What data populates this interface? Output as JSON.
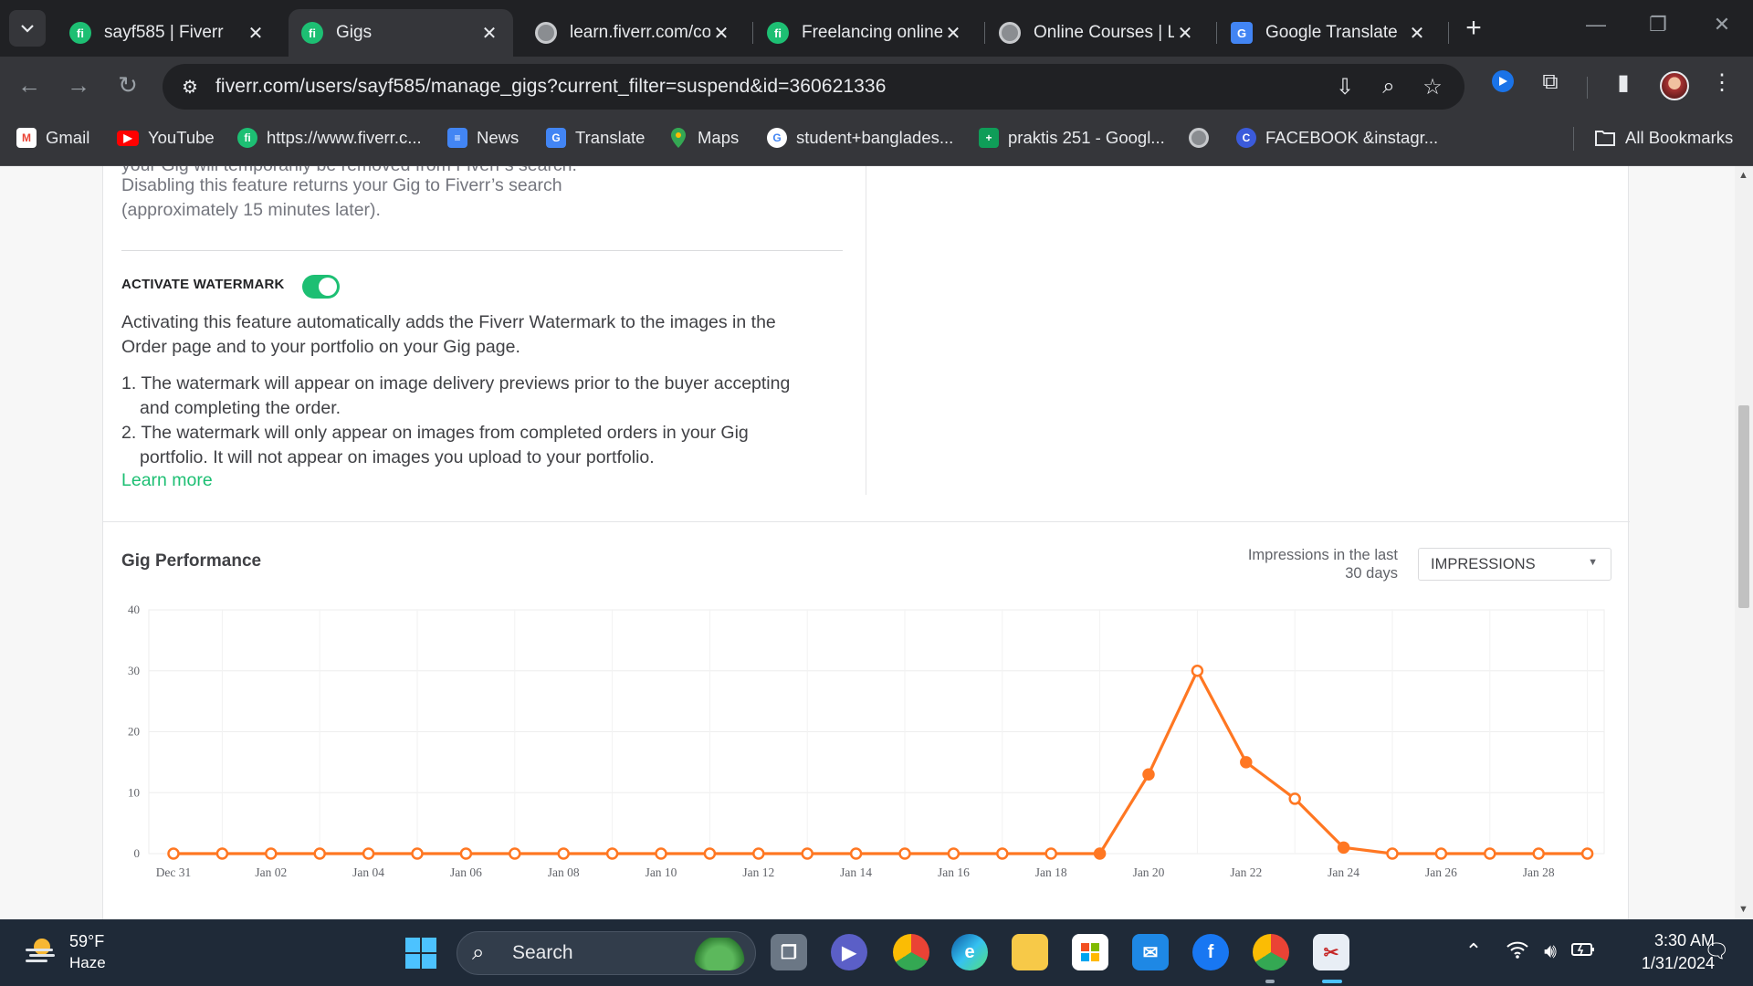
{
  "browser": {
    "tabs": [
      {
        "title": "sayf585 | Fiverr",
        "favicon": "fiverr-icon",
        "active": false
      },
      {
        "title": "Gigs",
        "favicon": "fiverr-icon",
        "active": true
      },
      {
        "title": "learn.fiverr.com/co",
        "favicon": "globe-icon",
        "active": false
      },
      {
        "title": "Freelancing online",
        "favicon": "fiverr-icon",
        "active": false
      },
      {
        "title": "Online Courses | Le",
        "favicon": "globe-icon",
        "active": false
      },
      {
        "title": "Google Translate",
        "favicon": "google-translate-icon",
        "active": false
      }
    ],
    "url": "fiverr.com/users/sayf585/manage_gigs?current_filter=suspend&id=360621336",
    "bookmarks": [
      {
        "label": "Gmail",
        "icon": "gmail-icon",
        "color": "#ea4335"
      },
      {
        "label": "YouTube",
        "icon": "youtube-icon",
        "color": "#ff0000"
      },
      {
        "label": "https://www.fiverr.c...",
        "icon": "fiverr-icon",
        "color": "#1dbf73"
      },
      {
        "label": "News",
        "icon": "google-news-icon",
        "color": "#4285f4"
      },
      {
        "label": "Translate",
        "icon": "google-translate-icon",
        "color": "#4285f4"
      },
      {
        "label": "Maps",
        "icon": "maps-pin-icon",
        "color": "#34a853"
      },
      {
        "label": "student+banglades...",
        "icon": "google-icon",
        "color": "#ffffff"
      },
      {
        "label": "praktis 251 - Googl...",
        "icon": "google-sheets-icon",
        "color": "#0f9d58"
      },
      {
        "label": "",
        "icon": "globe-icon",
        "color": "#8a8d91"
      },
      {
        "label": "FACEBOOK &instagr...",
        "icon": "canva-icon",
        "color": "#3b5bdb"
      }
    ],
    "all_bookmarks": "All Bookmarks"
  },
  "page": {
    "cut_text_line1": "your Gig will temporarily be removed from Fiverr's search.",
    "disable_text_line2": "Disabling this feature returns your Gig to Fiverr’s search",
    "disable_text_line3": "(approximately 15 minutes later).",
    "watermark_label": "ACTIVATE WATERMARK",
    "watermark_enabled": true,
    "watermark_desc_1": "Activating this feature automatically adds the Fiverr Watermark to the images in the",
    "watermark_desc_2": "Order page and to your portfolio on your Gig page.",
    "list_item_1a": "1. The watermark will appear on image delivery previews prior to the buyer accepting",
    "list_item_1b": "and completing the order.",
    "list_item_2a": "2. The watermark will only appear on images from completed orders in your Gig",
    "list_item_2b": "portfolio. It will not appear on images you upload to your portfolio.",
    "learn_more": "Learn more",
    "performance_title": "Gig Performance",
    "impressions_label_1": "Impressions in the last",
    "impressions_label_2": "30 days",
    "metric_select": "IMPRESSIONS"
  },
  "chart_data": {
    "type": "line",
    "x": [
      "Dec 31",
      "Jan 01",
      "Jan 02",
      "Jan 03",
      "Jan 04",
      "Jan 05",
      "Jan 06",
      "Jan 07",
      "Jan 08",
      "Jan 09",
      "Jan 10",
      "Jan 11",
      "Jan 12",
      "Jan 13",
      "Jan 14",
      "Jan 15",
      "Jan 16",
      "Jan 17",
      "Jan 18",
      "Jan 19",
      "Jan 20",
      "Jan 21",
      "Jan 22",
      "Jan 23",
      "Jan 24",
      "Jan 25",
      "Jan 26",
      "Jan 27",
      "Jan 28",
      "Jan 29"
    ],
    "x_tick_labels": [
      "Dec 31",
      "Jan 02",
      "Jan 04",
      "Jan 06",
      "Jan 08",
      "Jan 10",
      "Jan 12",
      "Jan 14",
      "Jan 16",
      "Jan 18",
      "Jan 20",
      "Jan 22",
      "Jan 24",
      "Jan 26",
      "Jan 28"
    ],
    "series": [
      {
        "values": [
          0,
          0,
          0,
          0,
          0,
          0,
          0,
          0,
          0,
          0,
          0,
          0,
          0,
          0,
          0,
          0,
          0,
          0,
          0,
          0,
          13,
          30,
          15,
          9,
          1,
          0,
          0,
          0,
          0,
          0
        ],
        "color": "#ff7722"
      }
    ],
    "y_ticks": [
      0,
      10,
      20,
      30,
      40
    ],
    "ylim": [
      0,
      40
    ],
    "grid": true
  },
  "taskbar": {
    "weather_temp": "59°F",
    "weather_desc": "Haze",
    "search_placeholder": "Search",
    "time": "3:30 AM",
    "date": "1/31/2024"
  }
}
